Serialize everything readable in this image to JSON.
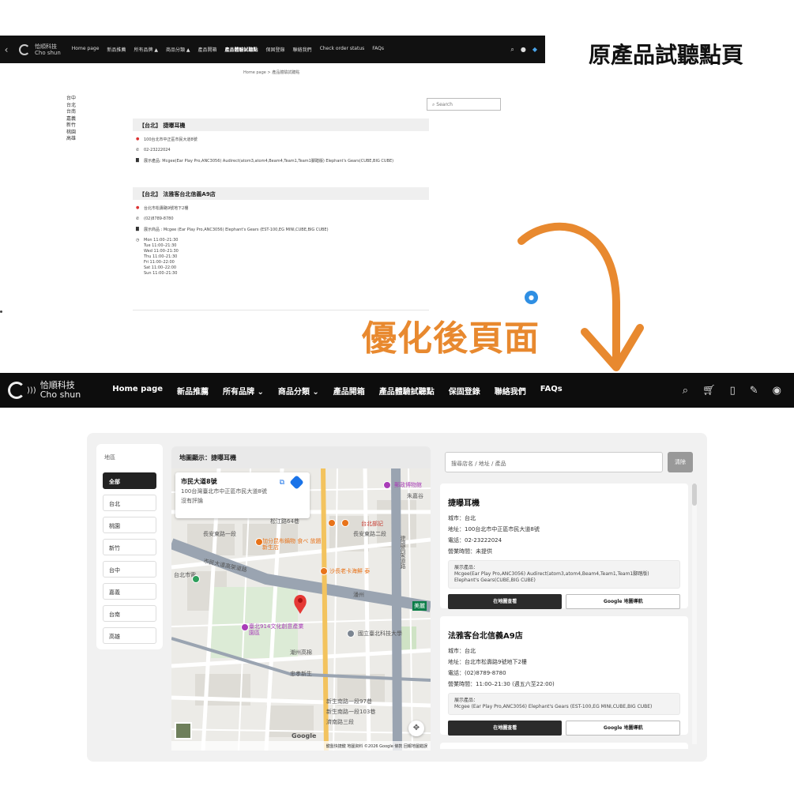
{
  "annotations": {
    "before_label": "原產品試聽點頁",
    "after_label": "優化後頁面"
  },
  "old_page": {
    "logo": {
      "cn": "恰順科技",
      "en": "Cho shun"
    },
    "nav": [
      "Home page",
      "新品推薦",
      "所有品牌 ▲",
      "商品分類 ▲",
      "產品開箱",
      "產品體驗試聽點",
      "保固登錄",
      "聯絡我們",
      "Check order status",
      "FAQs"
    ],
    "active_nav": "產品體驗試聽點",
    "breadcrumb": "Home page  >  產品體驗試聽點",
    "cities": [
      "台中",
      "台北",
      "台南",
      "嘉義",
      "新竹",
      "桃園",
      "高雄"
    ],
    "search_placeholder": "Search",
    "stores": [
      {
        "title": "【台北】 捷曝耳機",
        "address": "100台北市中正區市民大道8號",
        "phone": "02-23222024",
        "products": "展示產品: Mcgee(Ear Play Pro,ANC3056) Audirect(atom3,atom4,Beam4,Team1,Team1腳踏版) Elephant's Gears(CUBE,BIG CUBE)"
      },
      {
        "title": "【台北】 法雅客台北信義A9店",
        "address": "台北市松壽路9號地下2樓",
        "phone": "(02)8789-8780",
        "products": "展示商品 : Mcgee (Ear Play Pro,ANC3056) Elephant's Gears (EST-100,EG MINI,CUBE,BIG CUBE)",
        "hours": [
          "Mon 11:00–21:30",
          "Tue 11:00–21:30",
          "Wed 11:00–21:30",
          "Thu 11:00–21:30",
          "Fri 11:00–22:00",
          "Sat 11:00–22:00",
          "Sun 11:00–21:30"
        ]
      }
    ]
  },
  "new_page": {
    "logo": {
      "cn": "恰順科技",
      "en": "Cho shun"
    },
    "nav": [
      "Home page",
      "新品推薦",
      "所有品牌 ⌄",
      "商品分類 ⌄",
      "產品開箱",
      "產品體驗試聽點",
      "保固登錄",
      "聯絡我們",
      "FAQs"
    ],
    "region_title": "地區",
    "regions": [
      "全部",
      "台北",
      "桃園",
      "新竹",
      "台中",
      "嘉義",
      "台南",
      "高雄"
    ],
    "active_region": "全部",
    "map_header": "地圖顯示：捷曝耳機",
    "map_card": {
      "title": "市民大道8號",
      "address": "100台灣臺北市中正區市民大道8號",
      "reviews": "沒有評論"
    },
    "map_labels": {
      "l1": "郵政博物館",
      "l2": "朱嘉谷",
      "l3": "松江路64巷",
      "l4": "台北部記",
      "l5": "長安東路二段",
      "l6": "加分昆布鍋物 食べ 放題 新生店",
      "l7": "沙長老卡海鮮 泰",
      "l8": "市民大道高架道路",
      "l9": "國立臺北科技大學",
      "l10": "新生南路一段97巷",
      "l11": "新生南路一段103巷",
      "l12": "濟南路三段",
      "l13": "潮州高棉",
      "l14": "忠孝新生",
      "l15": "建國高架道路",
      "l16": "台北市電",
      "l17": "潘州",
      "l18": "臺北914文化創意產業園區",
      "l19": "美麗",
      "l20": "長安東路一段"
    },
    "map_footer": "鍵盤快捷鍵  地圖資料 ©2026 Google  條款  回報地圖錯誤",
    "search_placeholder": "搜尋店名 / 地址 / 產品",
    "clear_label": "清除",
    "stores": [
      {
        "name": "捷曝耳機",
        "city": "城市：台北",
        "address": "地址：100台北市中正區市民大道8號",
        "phone": "電話：02-23222024",
        "hours": "營業時間：未提供",
        "products_label": "展示產品：",
        "products": "Mcgee(Ear Play Pro,ANC3056) Audirect(atom3,atom4,Beam4,Team1,Team1腳踏版) Elephant's Gears(CUBE,BIG CUBE)",
        "btn_map": "在地圖查看",
        "btn_google": "Google 地圖導航"
      },
      {
        "name": "法雅客台北信義A9店",
        "city": "城市：台北",
        "address": "地址：台北市松壽路9號地下2樓",
        "phone": "電話：(02)8789-8780",
        "hours": "營業時間：11:00–21:30 (週五六至22:00)",
        "products_label": "展示產品：",
        "products": "Mcgee (Ear Play Pro,ANC3056) Elephant's Gears (EST-100,EG MINI,CUBE,BIG CUBE)",
        "btn_map": "在地圖查看",
        "btn_google": "Google 地圖導航"
      }
    ]
  },
  "colors": {
    "accent_orange": "#e8892f",
    "nav_bg": "#0d0d0d",
    "button_dark": "#2b2b2b",
    "map_pin": "#e53935"
  }
}
